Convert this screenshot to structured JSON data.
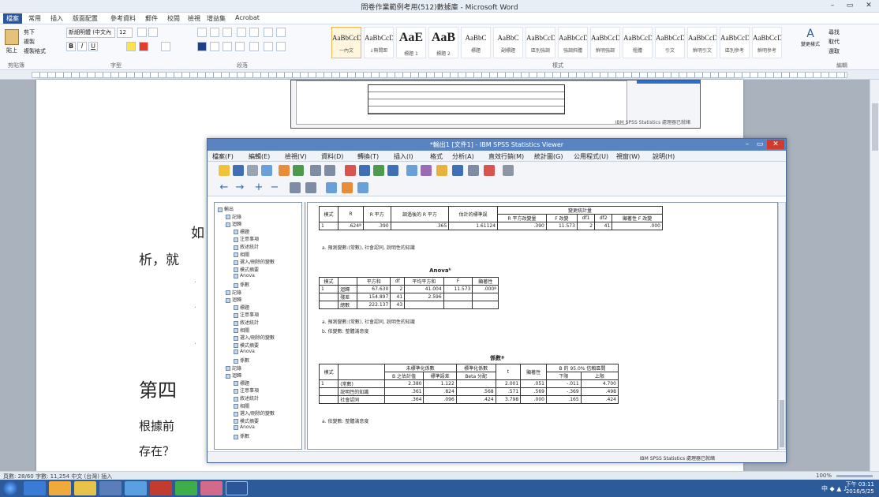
{
  "word": {
    "title": "問卷作業範例考用(512)數據庫 - Microsoft Word",
    "controls": {
      "min": "–",
      "max": "▭",
      "close": "✕"
    },
    "file_tab": "檔案",
    "tabs": [
      "常用",
      "插入",
      "版面配置",
      "參考資料",
      "郵件",
      "校閱",
      "檢視",
      "增益集",
      "Acrobat"
    ],
    "clipboard": {
      "paste": "貼上",
      "cut": "剪下",
      "copy": "複製",
      "painter": "複製格式"
    },
    "font_name": "新細明體 (中文內",
    "font_size": "12",
    "groups": [
      "剪貼簿",
      "字型",
      "段落",
      "樣式",
      "編輯"
    ],
    "styles": [
      {
        "preview": "AaBbCcD",
        "name": "一內文",
        "big": false
      },
      {
        "preview": "AaBbCcD",
        "name": "↓無間距",
        "big": false
      },
      {
        "preview": "AaE",
        "name": "標題 1",
        "big": true
      },
      {
        "preview": "AaB",
        "name": "標題 2",
        "big": true
      },
      {
        "preview": "AaBbC",
        "name": "標題",
        "big": false
      },
      {
        "preview": "AaBbC",
        "name": "副標題",
        "big": false
      },
      {
        "preview": "AaBbCcD",
        "name": "區別強調",
        "big": false
      },
      {
        "preview": "AaBbCcD",
        "name": "強調斜體",
        "big": false
      },
      {
        "preview": "AaBbCcD",
        "name": "鮮明強調",
        "big": false
      },
      {
        "preview": "AaBbCcD",
        "name": "粗體",
        "big": false
      },
      {
        "preview": "AaBbCcD",
        "name": "引文",
        "big": false
      },
      {
        "preview": "AaBbCcD",
        "name": "鮮明引文",
        "big": false
      },
      {
        "preview": "AaBbCcD",
        "name": "區別參考",
        "big": false
      },
      {
        "preview": "AaBbCcD",
        "name": "鮮明參考",
        "big": false
      }
    ],
    "change_styles": "變更樣式",
    "editing": {
      "find": "尋找",
      "replace": "取代",
      "select": "選取"
    },
    "doc_text": {
      "line1": "如",
      "line2": "析，就",
      "heading": "第四",
      "line3": "根據前",
      "line4": "存在？"
    },
    "embed_footer": "IBM SPSS Statistics 處理器已就緒",
    "status_left": "頁數: 28/60   字數: 11,254   中文 (台灣)   插入",
    "status_right": "100%"
  },
  "spss": {
    "title": "*輸出1 [文件1] - IBM SPSS Statistics Viewer",
    "controls": {
      "min": "–",
      "max": "▭",
      "close": "✕"
    },
    "menus": [
      "檔案(F)",
      "編輯(E)",
      "檢視(V)",
      "資料(D)",
      "轉換(T)",
      "插入(I)",
      "格式",
      "分析(A)",
      "直效行銷(M)",
      "統計圖(G)",
      "公用程式(U)",
      "視窗(W)",
      "說明(H)"
    ],
    "outline": [
      {
        "label": "輸出",
        "level": 0
      },
      {
        "label": "記錄",
        "level": 1
      },
      {
        "label": "迴歸",
        "level": 1
      },
      {
        "label": "標題",
        "level": 2
      },
      {
        "label": "注意事項",
        "level": 2
      },
      {
        "label": "敘述統計",
        "level": 2
      },
      {
        "label": "相關",
        "level": 2
      },
      {
        "label": "選入/刪除的變數",
        "level": 2
      },
      {
        "label": "模式摘要",
        "level": 2
      },
      {
        "label": "Anova",
        "level": 2
      },
      {
        "label": "係數",
        "level": 2
      },
      {
        "label": "記錄",
        "level": 1
      },
      {
        "label": "迴歸",
        "level": 1
      },
      {
        "label": "標題",
        "level": 2
      },
      {
        "label": "注意事項",
        "level": 2
      },
      {
        "label": "敘述統計",
        "level": 2
      },
      {
        "label": "相關",
        "level": 2
      },
      {
        "label": "選入/刪除的變數",
        "level": 2
      },
      {
        "label": "模式摘要",
        "level": 2
      },
      {
        "label": "Anova",
        "level": 2
      },
      {
        "label": "係數",
        "level": 2
      },
      {
        "label": "記錄",
        "level": 1
      },
      {
        "label": "迴歸",
        "level": 1
      },
      {
        "label": "標題",
        "level": 2
      },
      {
        "label": "注意事項",
        "level": 2
      },
      {
        "label": "敘述統計",
        "level": 2
      },
      {
        "label": "相關",
        "level": 2
      },
      {
        "label": "選入/刪除的變數",
        "level": 2
      },
      {
        "label": "模式摘要",
        "level": 2
      },
      {
        "label": "Anova",
        "level": 2
      },
      {
        "label": "係數",
        "level": 2
      }
    ],
    "model_summary": {
      "group_header": "變更統計量",
      "headers": [
        "模式",
        "R",
        "R 平方",
        "調過後的 R 平方",
        "估計的標準誤",
        "R 平方改變量",
        "F 改變",
        "df1",
        "df2",
        "顯著性 F 改變"
      ],
      "row": [
        "1",
        ".624ª",
        ".390",
        ".365",
        "1.61124",
        ".390",
        "11.573",
        "2",
        "41",
        ".000"
      ],
      "note": "a. 預測變數:(常數), 社會認同, 說明性的知識"
    },
    "anova": {
      "title": "Anovaᵇ",
      "headers": [
        "模式",
        "",
        "平方和",
        "df",
        "平均平方和",
        "F",
        "顯著性"
      ],
      "rows": [
        [
          "1",
          "迴歸",
          "67.630",
          "2",
          "41.004",
          "11.573",
          ".000ª"
        ],
        [
          "",
          "殘差",
          "154.897",
          "41",
          "2.596",
          "",
          ""
        ],
        [
          "",
          "總數",
          "222.137",
          "43",
          "",
          "",
          ""
        ]
      ],
      "note1": "a. 預測變數:(常數), 社會認同, 說明性的知識",
      "note2": "b. 依變數: 整體滿意度"
    },
    "coeff": {
      "title": "係數ª",
      "group1": "未標準化係數",
      "group2": "標準化係數",
      "group3": "B 的 95.0% 信賴區間",
      "headers": [
        "模式",
        "",
        "B 之估計值",
        "標準誤差",
        "Beta 分配",
        "t",
        "顯著性",
        "下限",
        "上限"
      ],
      "rows": [
        [
          "1",
          "(常數)",
          "2.380",
          "1.122",
          "",
          "2.001",
          ".051",
          "-.011",
          "4.700"
        ],
        [
          "",
          "說明性的知識",
          ".361",
          ".824",
          ".568",
          ".571",
          ".569",
          "-.369",
          ".498"
        ],
        [
          "",
          "社會認同",
          ".364",
          ".096",
          ".424",
          "3.798",
          ".000",
          ".165",
          ".424"
        ]
      ],
      "note": "a. 依變數: 整體滿意度"
    },
    "status": "IBM SPSS Statistics 處理器已就緒"
  },
  "taskbar": {
    "tray": "中 ◆ ▲ ♪",
    "time": "下午 03:11",
    "date": "2016/5/25"
  }
}
